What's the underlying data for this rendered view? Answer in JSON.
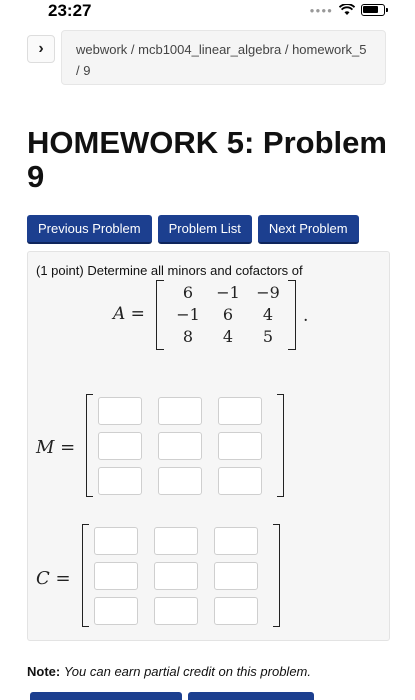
{
  "status": {
    "time": "23:27"
  },
  "breadcrumb": {
    "path": "webwork / mcb1004_linear_algebra / homework_5 / 9"
  },
  "page": {
    "title": "HOMEWORK 5: Problem 9"
  },
  "nav": {
    "previous": "Previous Problem",
    "list": "Problem List",
    "next": "Next Problem"
  },
  "problem": {
    "points": "(1 point)",
    "prompt": "Determine all minors and cofactors of",
    "matrix_name": "A",
    "matrix_a": [
      [
        "6",
        "−1",
        "−9"
      ],
      [
        "−1",
        "6",
        "4"
      ],
      [
        "8",
        "4",
        "5"
      ]
    ],
    "minor_label": "M",
    "cofactor_label": "C"
  },
  "note": {
    "label": "Note:",
    "text": "You can earn partial credit on this problem."
  }
}
